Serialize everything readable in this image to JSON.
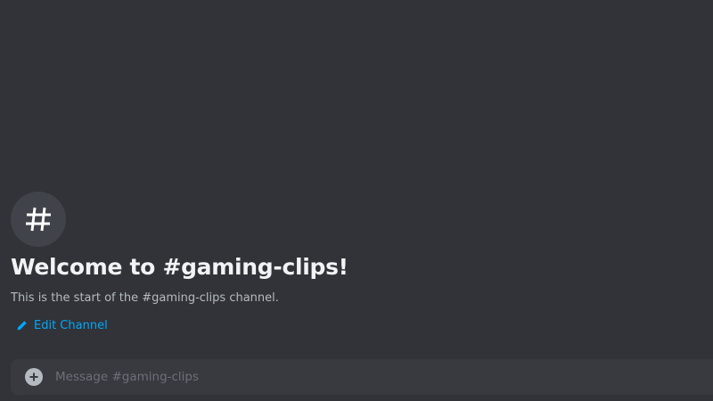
{
  "channel": {
    "icon": "hashtag-icon",
    "welcome_title": "Welcome to #gaming-clips!",
    "welcome_description": "This is the start of the #gaming-clips channel.",
    "edit_label": "Edit Channel",
    "edit_icon": "pencil-icon"
  },
  "composer": {
    "attach_icon": "plus-circle-icon",
    "placeholder": "Message #gaming-clips",
    "value": ""
  },
  "colors": {
    "background": "#313338",
    "composer_background": "#383a40",
    "link": "#00a8fc",
    "heading": "#f2f3f5",
    "muted_text": "#b5bac1"
  }
}
